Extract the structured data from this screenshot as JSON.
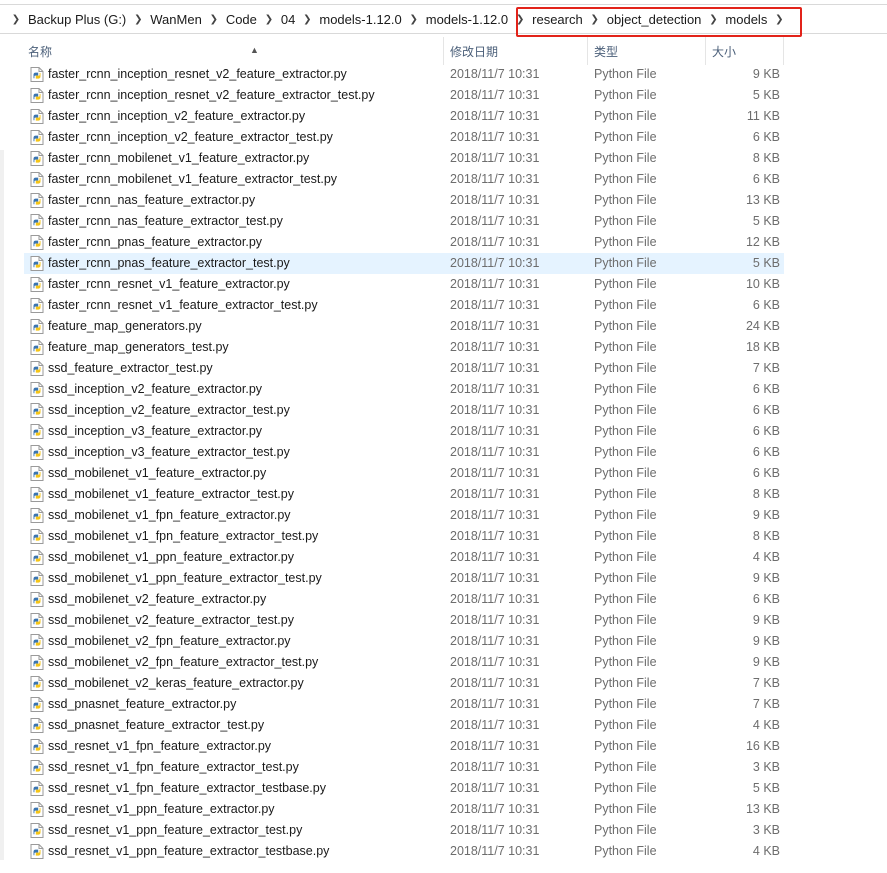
{
  "breadcrumb": [
    "Backup Plus (G:)",
    "WanMen",
    "Code",
    "04",
    "models-1.12.0",
    "models-1.12.0",
    "research",
    "object_detection",
    "models"
  ],
  "columns": {
    "name": "名称",
    "date": "修改日期",
    "type": "类型",
    "size": "大小"
  },
  "colors": {
    "highlight": "#e2231a",
    "selected_row": "#e5f3ff",
    "header_text": "#4c607a"
  },
  "selected_index": 9,
  "files": [
    {
      "name": "faster_rcnn_inception_resnet_v2_feature_extractor.py",
      "date": "2018/11/7 10:31",
      "type": "Python File",
      "size": "9 KB"
    },
    {
      "name": "faster_rcnn_inception_resnet_v2_feature_extractor_test.py",
      "date": "2018/11/7 10:31",
      "type": "Python File",
      "size": "5 KB"
    },
    {
      "name": "faster_rcnn_inception_v2_feature_extractor.py",
      "date": "2018/11/7 10:31",
      "type": "Python File",
      "size": "11 KB"
    },
    {
      "name": "faster_rcnn_inception_v2_feature_extractor_test.py",
      "date": "2018/11/7 10:31",
      "type": "Python File",
      "size": "6 KB"
    },
    {
      "name": "faster_rcnn_mobilenet_v1_feature_extractor.py",
      "date": "2018/11/7 10:31",
      "type": "Python File",
      "size": "8 KB"
    },
    {
      "name": "faster_rcnn_mobilenet_v1_feature_extractor_test.py",
      "date": "2018/11/7 10:31",
      "type": "Python File",
      "size": "6 KB"
    },
    {
      "name": "faster_rcnn_nas_feature_extractor.py",
      "date": "2018/11/7 10:31",
      "type": "Python File",
      "size": "13 KB"
    },
    {
      "name": "faster_rcnn_nas_feature_extractor_test.py",
      "date": "2018/11/7 10:31",
      "type": "Python File",
      "size": "5 KB"
    },
    {
      "name": "faster_rcnn_pnas_feature_extractor.py",
      "date": "2018/11/7 10:31",
      "type": "Python File",
      "size": "12 KB"
    },
    {
      "name": "faster_rcnn_pnas_feature_extractor_test.py",
      "date": "2018/11/7 10:31",
      "type": "Python File",
      "size": "5 KB"
    },
    {
      "name": "faster_rcnn_resnet_v1_feature_extractor.py",
      "date": "2018/11/7 10:31",
      "type": "Python File",
      "size": "10 KB"
    },
    {
      "name": "faster_rcnn_resnet_v1_feature_extractor_test.py",
      "date": "2018/11/7 10:31",
      "type": "Python File",
      "size": "6 KB"
    },
    {
      "name": "feature_map_generators.py",
      "date": "2018/11/7 10:31",
      "type": "Python File",
      "size": "24 KB"
    },
    {
      "name": "feature_map_generators_test.py",
      "date": "2018/11/7 10:31",
      "type": "Python File",
      "size": "18 KB"
    },
    {
      "name": "ssd_feature_extractor_test.py",
      "date": "2018/11/7 10:31",
      "type": "Python File",
      "size": "7 KB"
    },
    {
      "name": "ssd_inception_v2_feature_extractor.py",
      "date": "2018/11/7 10:31",
      "type": "Python File",
      "size": "6 KB"
    },
    {
      "name": "ssd_inception_v2_feature_extractor_test.py",
      "date": "2018/11/7 10:31",
      "type": "Python File",
      "size": "6 KB"
    },
    {
      "name": "ssd_inception_v3_feature_extractor.py",
      "date": "2018/11/7 10:31",
      "type": "Python File",
      "size": "6 KB"
    },
    {
      "name": "ssd_inception_v3_feature_extractor_test.py",
      "date": "2018/11/7 10:31",
      "type": "Python File",
      "size": "6 KB"
    },
    {
      "name": "ssd_mobilenet_v1_feature_extractor.py",
      "date": "2018/11/7 10:31",
      "type": "Python File",
      "size": "6 KB"
    },
    {
      "name": "ssd_mobilenet_v1_feature_extractor_test.py",
      "date": "2018/11/7 10:31",
      "type": "Python File",
      "size": "8 KB"
    },
    {
      "name": "ssd_mobilenet_v1_fpn_feature_extractor.py",
      "date": "2018/11/7 10:31",
      "type": "Python File",
      "size": "9 KB"
    },
    {
      "name": "ssd_mobilenet_v1_fpn_feature_extractor_test.py",
      "date": "2018/11/7 10:31",
      "type": "Python File",
      "size": "8 KB"
    },
    {
      "name": "ssd_mobilenet_v1_ppn_feature_extractor.py",
      "date": "2018/11/7 10:31",
      "type": "Python File",
      "size": "4 KB"
    },
    {
      "name": "ssd_mobilenet_v1_ppn_feature_extractor_test.py",
      "date": "2018/11/7 10:31",
      "type": "Python File",
      "size": "9 KB"
    },
    {
      "name": "ssd_mobilenet_v2_feature_extractor.py",
      "date": "2018/11/7 10:31",
      "type": "Python File",
      "size": "6 KB"
    },
    {
      "name": "ssd_mobilenet_v2_feature_extractor_test.py",
      "date": "2018/11/7 10:31",
      "type": "Python File",
      "size": "9 KB"
    },
    {
      "name": "ssd_mobilenet_v2_fpn_feature_extractor.py",
      "date": "2018/11/7 10:31",
      "type": "Python File",
      "size": "9 KB"
    },
    {
      "name": "ssd_mobilenet_v2_fpn_feature_extractor_test.py",
      "date": "2018/11/7 10:31",
      "type": "Python File",
      "size": "9 KB"
    },
    {
      "name": "ssd_mobilenet_v2_keras_feature_extractor.py",
      "date": "2018/11/7 10:31",
      "type": "Python File",
      "size": "7 KB"
    },
    {
      "name": "ssd_pnasnet_feature_extractor.py",
      "date": "2018/11/7 10:31",
      "type": "Python File",
      "size": "7 KB"
    },
    {
      "name": "ssd_pnasnet_feature_extractor_test.py",
      "date": "2018/11/7 10:31",
      "type": "Python File",
      "size": "4 KB"
    },
    {
      "name": "ssd_resnet_v1_fpn_feature_extractor.py",
      "date": "2018/11/7 10:31",
      "type": "Python File",
      "size": "16 KB"
    },
    {
      "name": "ssd_resnet_v1_fpn_feature_extractor_test.py",
      "date": "2018/11/7 10:31",
      "type": "Python File",
      "size": "3 KB"
    },
    {
      "name": "ssd_resnet_v1_fpn_feature_extractor_testbase.py",
      "date": "2018/11/7 10:31",
      "type": "Python File",
      "size": "5 KB"
    },
    {
      "name": "ssd_resnet_v1_ppn_feature_extractor.py",
      "date": "2018/11/7 10:31",
      "type": "Python File",
      "size": "13 KB"
    },
    {
      "name": "ssd_resnet_v1_ppn_feature_extractor_test.py",
      "date": "2018/11/7 10:31",
      "type": "Python File",
      "size": "3 KB"
    },
    {
      "name": "ssd_resnet_v1_ppn_feature_extractor_testbase.py",
      "date": "2018/11/7 10:31",
      "type": "Python File",
      "size": "4 KB"
    }
  ]
}
